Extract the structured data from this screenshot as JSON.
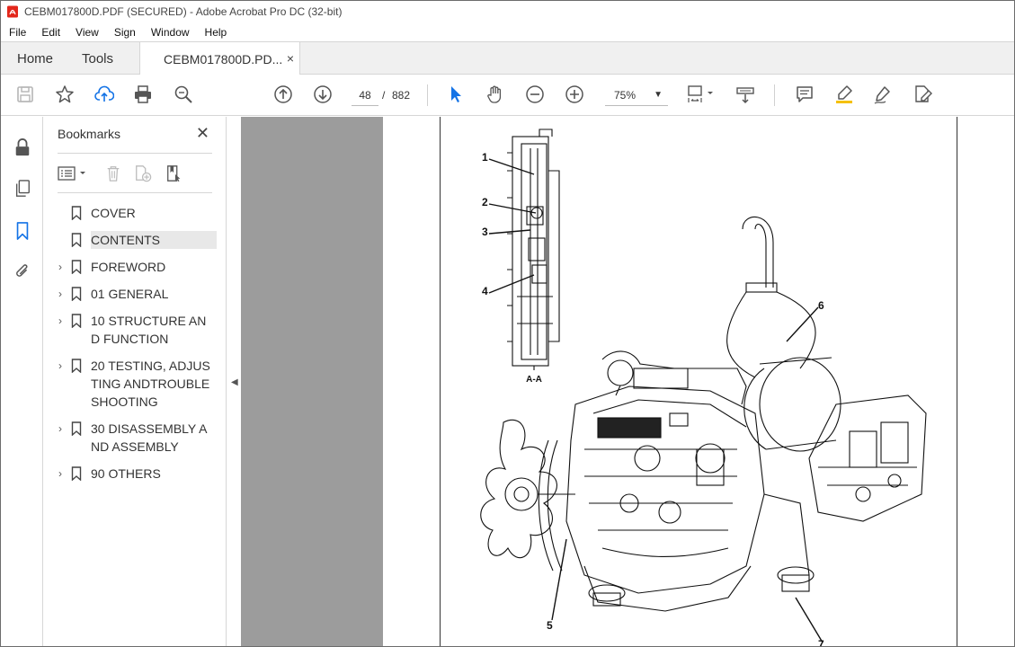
{
  "window": {
    "title": "CEBM017800D.PDF (SECURED) - Adobe Acrobat Pro DC (32-bit)"
  },
  "menu": [
    "File",
    "Edit",
    "View",
    "Sign",
    "Window",
    "Help"
  ],
  "tabs": {
    "home": "Home",
    "tools": "Tools",
    "document": "CEBM017800D.PD...",
    "close_symbol": "×"
  },
  "toolbar": {
    "current_page": "48",
    "page_separator": "/",
    "total_pages": "882",
    "zoom": "75%",
    "icons": [
      "save-icon",
      "bookmark-star-icon",
      "upload-icon",
      "print-icon",
      "zoom-search-icon",
      "page-up-icon",
      "page-down-icon",
      "select-arrow-icon",
      "hand-icon",
      "zoom-out-icon",
      "zoom-in-icon",
      "fit-page-icon",
      "scroll-mode-icon",
      "comment-icon",
      "highlight-icon",
      "draw-icon",
      "fill-sign-icon"
    ]
  },
  "bookmarks": {
    "title": "Bookmarks",
    "close_symbol": "✕",
    "items": [
      {
        "label": "COVER",
        "expandable": false,
        "selected": false
      },
      {
        "label": "CONTENTS",
        "expandable": false,
        "selected": true
      },
      {
        "label": "FOREWORD",
        "expandable": true,
        "selected": false
      },
      {
        "label": "01 GENERAL",
        "expandable": true,
        "selected": false
      },
      {
        "label": "10 STRUCTURE AND FUNCTION",
        "expandable": true,
        "selected": false
      },
      {
        "label": "20 TESTING, ADJUSTING ANDTROUBLESHOOTING",
        "expandable": true,
        "selected": false
      },
      {
        "label": "30 DISASSEMBLY AND ASSEMBLY",
        "expandable": true,
        "selected": false
      },
      {
        "label": "90 OTHERS",
        "expandable": true,
        "selected": false
      }
    ]
  },
  "document": {
    "callouts": [
      "1",
      "2",
      "3",
      "4",
      "5",
      "6",
      "7"
    ],
    "section_label": "A-A"
  },
  "colors": {
    "accent": "#1473e6",
    "gray_bar": "#9c9c9c",
    "selected_bookmark": "#e8e8e8"
  }
}
